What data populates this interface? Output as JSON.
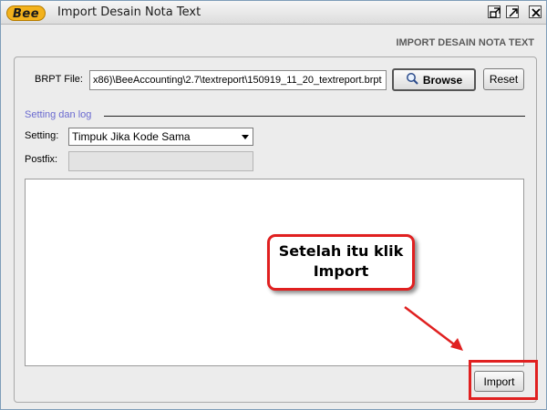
{
  "window": {
    "logo_text": "Bee",
    "title": "Import Desain Nota Text"
  },
  "header": {
    "title": "IMPORT DESAIN NOTA TEXT"
  },
  "form": {
    "brpt_label": "BRPT File:",
    "brpt_value": "x86)\\BeeAccounting\\2.7\\textreport\\150919_11_20_textreport.brpt",
    "browse_label": "Browse",
    "reset_label": "Reset",
    "section_title": "Setting dan log",
    "setting_label": "Setting:",
    "setting_value": "Timpuk Jika Kode Sama",
    "postfix_label": "Postfix:",
    "postfix_value": ""
  },
  "callout": {
    "line1": "Setelah itu klik",
    "line2": "Import"
  },
  "footer": {
    "import_label": "Import"
  },
  "colors": {
    "annotation_red": "#e02020",
    "section_title": "#6a6ad0"
  }
}
